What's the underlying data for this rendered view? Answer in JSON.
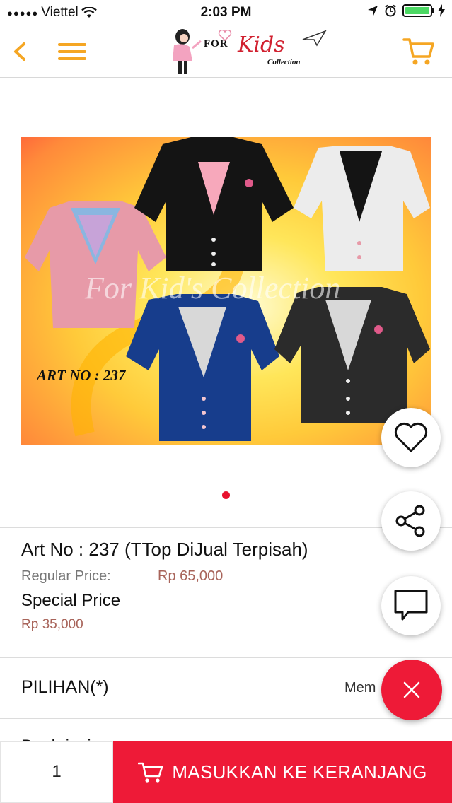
{
  "status_bar": {
    "carrier": "Viettel",
    "signal_dots": "●●●●●",
    "time": "2:03 PM",
    "battery_level": 1.0
  },
  "header": {
    "logo": {
      "for": "FOR",
      "kids": "Kids",
      "collection": "Collection"
    }
  },
  "product": {
    "image_art_label": "ART NO : 237",
    "image_watermark": "For Kid's Collection",
    "title": "Art No : 237 (TTop DiJual Terpisah)",
    "regular_price_label": "Regular Price:",
    "regular_price": "Rp 65,000",
    "special_price_label": "Special Price",
    "special_price": "Rp 35,000",
    "carousel_pages": 1,
    "carousel_active": 1
  },
  "options": {
    "label": "PILIHAN(*)",
    "value": "Mem"
  },
  "next_section_peek": "Deskripsi",
  "bottom_bar": {
    "quantity": "1",
    "add_to_cart_label": "MASUKKAN KE KERANJANG"
  },
  "colors": {
    "accent_orange": "#f5a623",
    "accent_red": "#ee1a37",
    "price_color": "#a8645a"
  },
  "icons": [
    "back-chevron-icon",
    "menu-icon",
    "cart-icon",
    "heart-icon",
    "share-icon",
    "chat-icon",
    "close-icon"
  ]
}
